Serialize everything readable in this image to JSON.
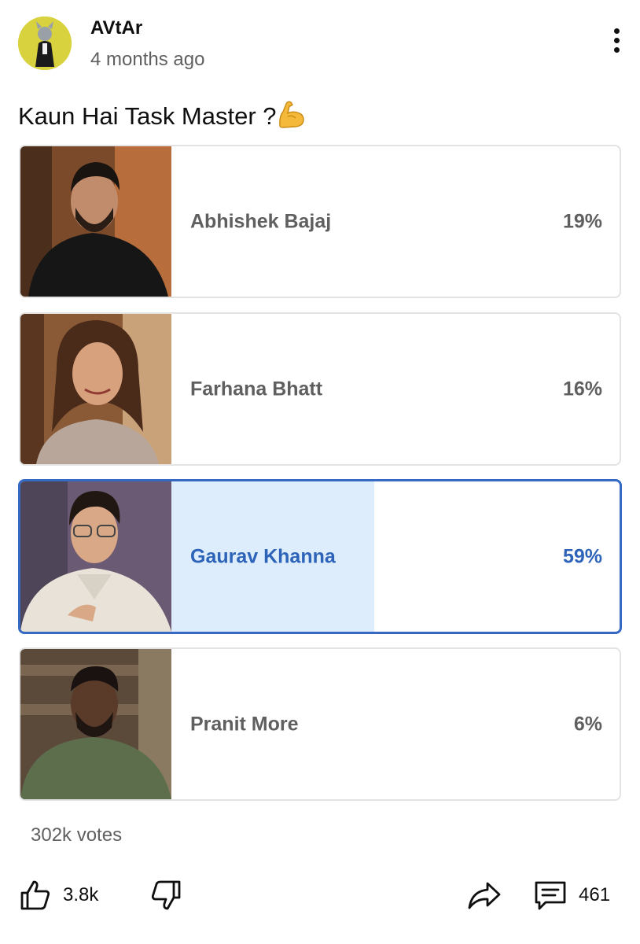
{
  "post": {
    "author": "AVtAr",
    "time": "4 months ago",
    "title": "Kaun Hai Task Master ?",
    "title_emoji": "flexed-biceps-emoji"
  },
  "poll": {
    "options": [
      {
        "name": "Abhishek Bajaj",
        "percent_label": "19%",
        "percent": 19,
        "selected": false
      },
      {
        "name": "Farhana Bhatt",
        "percent_label": "16%",
        "percent": 16,
        "selected": false
      },
      {
        "name": "Gaurav Khanna",
        "percent_label": "59%",
        "percent": 59,
        "selected": true
      },
      {
        "name": "Pranit More",
        "percent_label": "6%",
        "percent": 6,
        "selected": false
      }
    ],
    "votes": "302k votes"
  },
  "actions": {
    "likes": "3.8k",
    "comments": "461",
    "icons": [
      "thumbs-up-icon",
      "thumbs-down-icon",
      "share-icon",
      "comment-icon"
    ]
  },
  "colors": {
    "selected_border": "#3569c4",
    "selected_fill": "#deedfb",
    "selected_text": "#2d63b8",
    "bar_fill": "#e6e6e6"
  }
}
